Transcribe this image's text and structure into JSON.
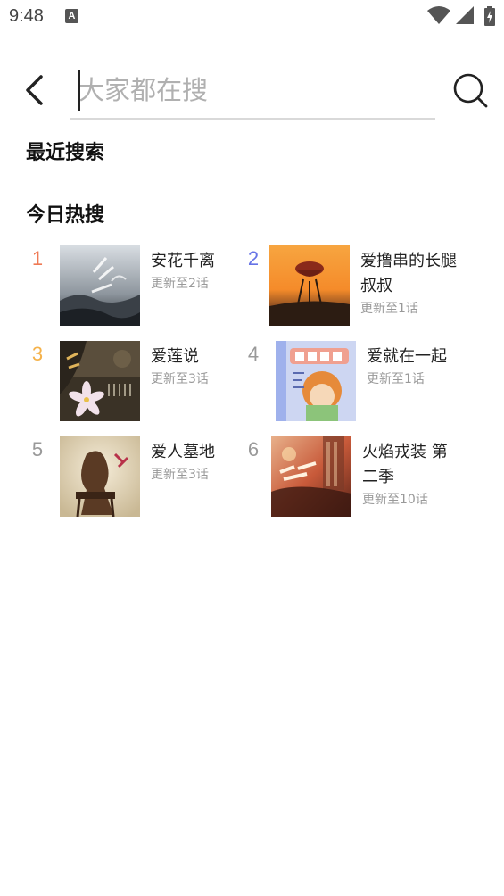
{
  "status_bar": {
    "time": "9:48",
    "notification_icon_letter": "A",
    "icons": [
      "wifi-icon",
      "cell-signal-icon",
      "battery-charging-icon"
    ]
  },
  "search": {
    "placeholder": "大家都在搜",
    "value": ""
  },
  "sections": {
    "recent": "最近搜索",
    "hot": "今日热搜"
  },
  "colors": {
    "rank1": "#ef7a55",
    "rank2": "#6673e6",
    "rank3": "#f5b24a",
    "rank_default": "#999999",
    "divider": "#d9d9d9"
  },
  "hot_items": [
    {
      "rank": "1",
      "title": "安花千离",
      "subtitle": "更新至2话"
    },
    {
      "rank": "2",
      "title": "爱撸串的长腿叔叔",
      "subtitle": "更新至1话"
    },
    {
      "rank": "3",
      "title": "爱莲说",
      "subtitle": "更新至3话"
    },
    {
      "rank": "4",
      "title": "爱就在一起",
      "subtitle": "更新至1话"
    },
    {
      "rank": "5",
      "title": "爱人墓地",
      "subtitle": "更新至3话"
    },
    {
      "rank": "6",
      "title": "火焰戎装 第二季",
      "subtitle": "更新至10话"
    }
  ]
}
